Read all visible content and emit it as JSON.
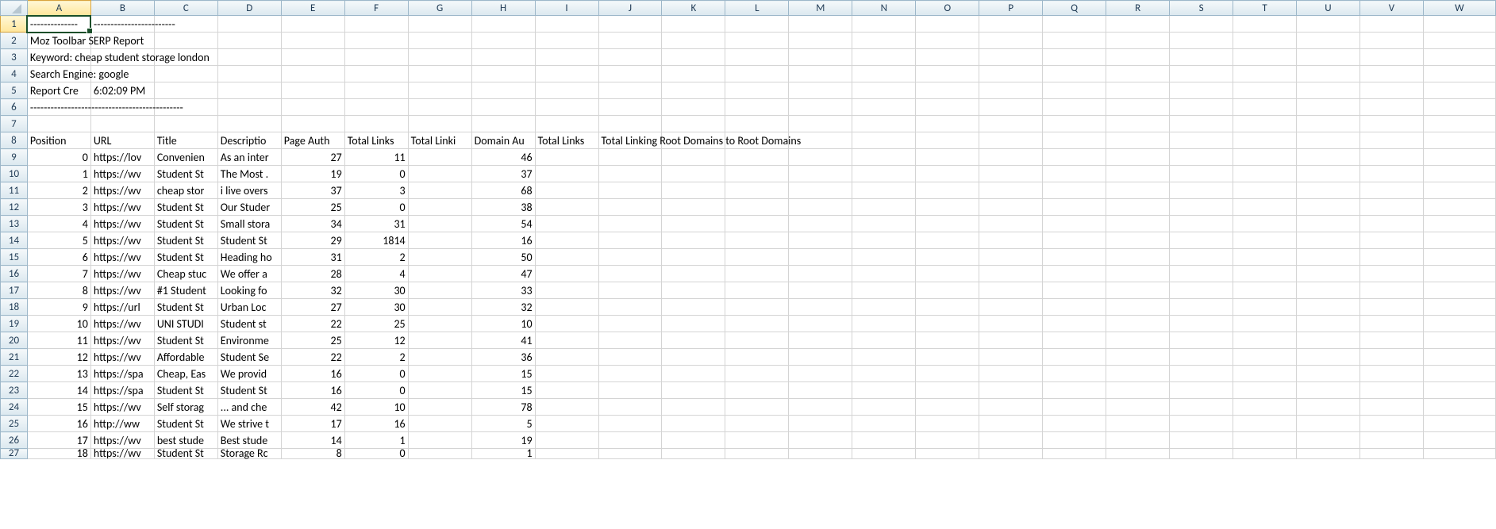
{
  "columns": [
    "A",
    "B",
    "C",
    "D",
    "E",
    "F",
    "G",
    "H",
    "I",
    "J",
    "K",
    "L",
    "M",
    "N",
    "O",
    "P",
    "Q",
    "R",
    "S",
    "T",
    "U",
    "V",
    "W"
  ],
  "selected_col": "A",
  "selected_row": 1,
  "meta_rows": {
    "1": "--------------",
    "1_overflow": "------------------------",
    "2": "Moz Toolbar SERP Report",
    "3": "Keyword: cheap student storage london",
    "4": "Search Engine: google",
    "5_a": "Report Cre",
    "5_b": "6:02:09 PM",
    "6": "---------------------------------------------"
  },
  "headers": {
    "A": "Position",
    "B": "URL",
    "C": "Title",
    "D": "Descriptio",
    "E": "Page Auth",
    "F": "Total Links",
    "G": "Total Linki",
    "H": "Domain Au",
    "I": "Total Links",
    "J_overflow": "Total Linking Root Domains to Root Domains"
  },
  "rows": [
    {
      "pos": 0,
      "url": "https://lov",
      "title": "Convenien",
      "desc": "As an inter",
      "pa": 27,
      "tl": 11,
      "da": 46
    },
    {
      "pos": 1,
      "url": "https://wv",
      "title": "Student St",
      "desc": "The Most .",
      "pa": 19,
      "tl": 0,
      "da": 37
    },
    {
      "pos": 2,
      "url": "https://wv",
      "title": "cheap stor",
      "desc": "i live overs",
      "pa": 37,
      "tl": 3,
      "da": 68
    },
    {
      "pos": 3,
      "url": "https://wv",
      "title": "Student St",
      "desc": "Our Studer",
      "pa": 25,
      "tl": 0,
      "da": 38
    },
    {
      "pos": 4,
      "url": "https://wv",
      "title": "Student St",
      "desc": "Small stora",
      "pa": 34,
      "tl": 31,
      "da": 54
    },
    {
      "pos": 5,
      "url": "https://wv",
      "title": "Student St",
      "desc": "Student St",
      "pa": 29,
      "tl": 1814,
      "da": 16
    },
    {
      "pos": 6,
      "url": "https://wv",
      "title": "Student St",
      "desc": "Heading ho",
      "pa": 31,
      "tl": 2,
      "da": 50
    },
    {
      "pos": 7,
      "url": "https://wv",
      "title": "Cheap stuc",
      "desc": "We offer a",
      "pa": 28,
      "tl": 4,
      "da": 47
    },
    {
      "pos": 8,
      "url": "https://wv",
      "title": "#1 Student",
      "desc": "Looking fo",
      "pa": 32,
      "tl": 30,
      "da": 33
    },
    {
      "pos": 9,
      "url": "https://url",
      "title": "Student St",
      "desc": "Urban Loc",
      "pa": 27,
      "tl": 30,
      "da": 32
    },
    {
      "pos": 10,
      "url": "https://wv",
      "title": "UNI STUDI",
      "desc": "Student st",
      "pa": 22,
      "tl": 25,
      "da": 10
    },
    {
      "pos": 11,
      "url": "https://wv",
      "title": "Student St",
      "desc": "Environme",
      "pa": 25,
      "tl": 12,
      "da": 41
    },
    {
      "pos": 12,
      "url": "https://wv",
      "title": "Affordable",
      "desc": "Student Se",
      "pa": 22,
      "tl": 2,
      "da": 36
    },
    {
      "pos": 13,
      "url": "https://spa",
      "title": "Cheap, Eas",
      "desc": "We provid",
      "pa": 16,
      "tl": 0,
      "da": 15
    },
    {
      "pos": 14,
      "url": "https://spa",
      "title": "Student St",
      "desc": "Student St",
      "pa": 16,
      "tl": 0,
      "da": 15
    },
    {
      "pos": 15,
      "url": "https://wv",
      "title": "Self storag",
      "desc": "... and che",
      "pa": 42,
      "tl": 10,
      "da": 78
    },
    {
      "pos": 16,
      "url": "http://ww",
      "title": "Student St",
      "desc": "We strive t",
      "pa": 17,
      "tl": 16,
      "da": 5
    },
    {
      "pos": 17,
      "url": "https://wv",
      "title": "best stude",
      "desc": "Best stude",
      "pa": 14,
      "tl": 1,
      "da": 19
    },
    {
      "pos": 18,
      "url": "https://wv",
      "title": "Student St",
      "desc": "Storage Rc",
      "pa": 8,
      "tl": 0,
      "da": 1
    }
  ]
}
